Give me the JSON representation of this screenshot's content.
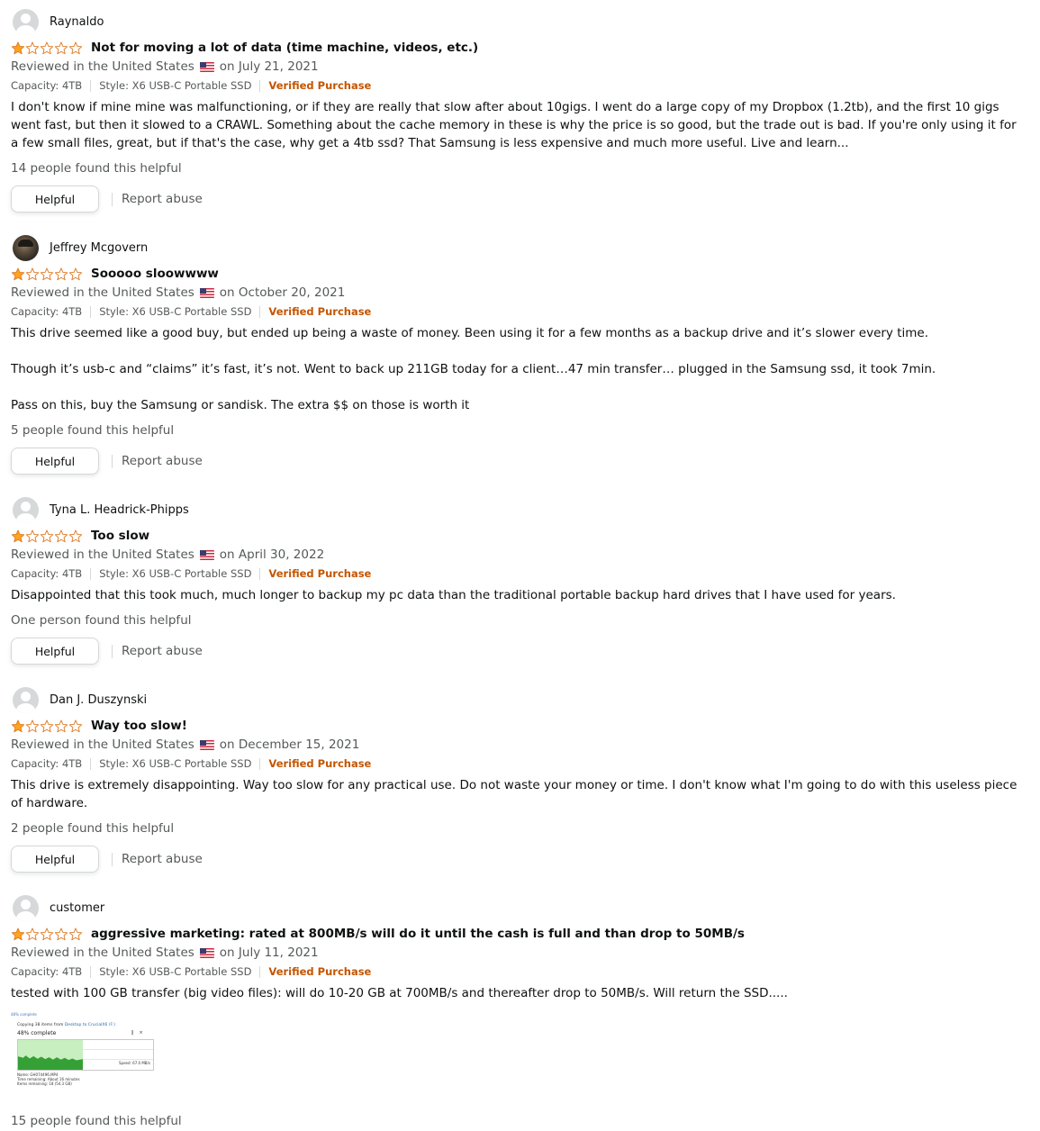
{
  "colors": {
    "star": "#ffa41c",
    "star_outline": "#de7921",
    "verified": "#c45500",
    "muted_text": "#565959"
  },
  "labels": {
    "helpful": "Helpful",
    "report_abuse": "Report abuse",
    "reviewed_in": "Reviewed in the United States",
    "verified_purchase": "Verified Purchase"
  },
  "reviews": [
    {
      "profile_name": "Raynaldo",
      "avatar": "default-avatar-icon",
      "rating": 1,
      "max_rating": 5,
      "title": "Not for moving a lot of data (time machine, videos, etc.)",
      "date": "on July 21, 2021",
      "capacity": "Capacity: 4TB",
      "style": "Style: X6 USB-C Portable SSD",
      "body": "I don't know if mine mine was malfunctioning, or if they are really that slow after about 10gigs. I went do a large copy of my Dropbox (1.2tb), and the first 10 gigs went fast, but then it slowed to a CRAWL. Something about the cache memory in these is why the price is so good, but the trade out is bad. If you're only using it for a few small files, great, but if that's the case, why get a 4tb ssd? That Samsung is less expensive and much more useful. Live and learn...",
      "helpful_text": "14 people found this helpful"
    },
    {
      "profile_name": "Jeffrey Mcgovern",
      "avatar": "profile-photo",
      "rating": 1,
      "max_rating": 5,
      "title": "Sooooo sloowwww",
      "date": "on October 20, 2021",
      "capacity": "Capacity: 4TB",
      "style": "Style: X6 USB-C Portable SSD",
      "body": "This drive seemed like a good buy, but ended up being a waste of money. Been using it for a few months as a backup drive and it’s slower every time.\n\nThough it’s usb-c and “claims” it’s fast, it’s not. Went to back up 211GB today for a client…47 min transfer… plugged in the Samsung ssd, it took 7min.\n\nPass on this, buy the Samsung or sandisk. The extra $$ on those is worth it",
      "helpful_text": "5 people found this helpful"
    },
    {
      "profile_name": "Tyna L. Headrick-Phipps",
      "avatar": "default-avatar-icon",
      "rating": 1,
      "max_rating": 5,
      "title": "Too slow",
      "date": "on April 30, 2022",
      "capacity": "Capacity: 4TB",
      "style": "Style: X6 USB-C Portable SSD",
      "body": "Disappointed that this took much, much longer to backup my pc data than the traditional portable backup hard drives that I have used for years.",
      "helpful_text": "One person found this helpful"
    },
    {
      "profile_name": "Dan J. Duszynski",
      "avatar": "default-avatar-icon",
      "rating": 1,
      "max_rating": 5,
      "title": "Way too slow!",
      "date": "on December 15, 2021",
      "capacity": "Capacity: 4TB",
      "style": "Style: X6 USB-C Portable SSD",
      "body": "This drive is extremely disappointing. Way too slow for any practical use. Do not waste your money or time. I don't know what I'm going to do with this useless piece of hardware.",
      "helpful_text": "2 people found this helpful"
    },
    {
      "profile_name": "customer",
      "avatar": "default-avatar-icon",
      "rating": 1,
      "max_rating": 5,
      "title": "aggressive marketing: rated at 800MB/s will do it until the cash is full and than drop to 50MB/s",
      "date": "on July 11, 2021",
      "capacity": "Capacity: 4TB",
      "style": "Style: X6 USB-C Portable SSD",
      "body": "tested with 100 GB transfer (big video files): will do 10-20 GB at 700MB/s and thereafter drop to 50MB/s. Will return the SSD.....",
      "helpful_text": "15 people found this helpful",
      "image": {
        "window_title": "48% complete",
        "copying_prefix": "Copying 38 items from",
        "copying_source": "Desktop",
        "copying_mid": "to",
        "copying_dest": "CrucialX6 (F:)",
        "percent_text": "48% complete",
        "progress": 0.48,
        "speed": "Speed: 67.0 MB/s",
        "name_line": "Name: GH074496.MP4",
        "time_line": "Time remaining: About 16 minutes",
        "items_line": "Items remaining: 18 (54.3 GB)"
      }
    }
  ]
}
